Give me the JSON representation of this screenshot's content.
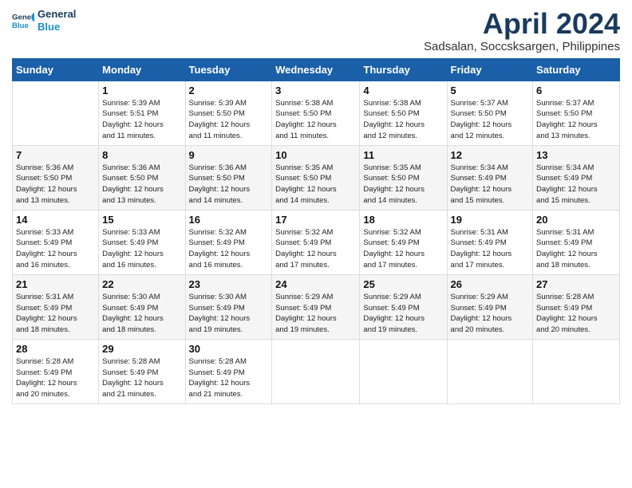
{
  "header": {
    "logo_line1": "General",
    "logo_line2": "Blue",
    "month": "April 2024",
    "location": "Sadsalan, Soccsksargen, Philippines"
  },
  "weekdays": [
    "Sunday",
    "Monday",
    "Tuesday",
    "Wednesday",
    "Thursday",
    "Friday",
    "Saturday"
  ],
  "weeks": [
    [
      {
        "day": "",
        "info": ""
      },
      {
        "day": "1",
        "info": "Sunrise: 5:39 AM\nSunset: 5:51 PM\nDaylight: 12 hours\nand 11 minutes."
      },
      {
        "day": "2",
        "info": "Sunrise: 5:39 AM\nSunset: 5:50 PM\nDaylight: 12 hours\nand 11 minutes."
      },
      {
        "day": "3",
        "info": "Sunrise: 5:38 AM\nSunset: 5:50 PM\nDaylight: 12 hours\nand 11 minutes."
      },
      {
        "day": "4",
        "info": "Sunrise: 5:38 AM\nSunset: 5:50 PM\nDaylight: 12 hours\nand 12 minutes."
      },
      {
        "day": "5",
        "info": "Sunrise: 5:37 AM\nSunset: 5:50 PM\nDaylight: 12 hours\nand 12 minutes."
      },
      {
        "day": "6",
        "info": "Sunrise: 5:37 AM\nSunset: 5:50 PM\nDaylight: 12 hours\nand 13 minutes."
      }
    ],
    [
      {
        "day": "7",
        "info": "Sunrise: 5:36 AM\nSunset: 5:50 PM\nDaylight: 12 hours\nand 13 minutes."
      },
      {
        "day": "8",
        "info": "Sunrise: 5:36 AM\nSunset: 5:50 PM\nDaylight: 12 hours\nand 13 minutes."
      },
      {
        "day": "9",
        "info": "Sunrise: 5:36 AM\nSunset: 5:50 PM\nDaylight: 12 hours\nand 14 minutes."
      },
      {
        "day": "10",
        "info": "Sunrise: 5:35 AM\nSunset: 5:50 PM\nDaylight: 12 hours\nand 14 minutes."
      },
      {
        "day": "11",
        "info": "Sunrise: 5:35 AM\nSunset: 5:50 PM\nDaylight: 12 hours\nand 14 minutes."
      },
      {
        "day": "12",
        "info": "Sunrise: 5:34 AM\nSunset: 5:49 PM\nDaylight: 12 hours\nand 15 minutes."
      },
      {
        "day": "13",
        "info": "Sunrise: 5:34 AM\nSunset: 5:49 PM\nDaylight: 12 hours\nand 15 minutes."
      }
    ],
    [
      {
        "day": "14",
        "info": "Sunrise: 5:33 AM\nSunset: 5:49 PM\nDaylight: 12 hours\nand 16 minutes."
      },
      {
        "day": "15",
        "info": "Sunrise: 5:33 AM\nSunset: 5:49 PM\nDaylight: 12 hours\nand 16 minutes."
      },
      {
        "day": "16",
        "info": "Sunrise: 5:32 AM\nSunset: 5:49 PM\nDaylight: 12 hours\nand 16 minutes."
      },
      {
        "day": "17",
        "info": "Sunrise: 5:32 AM\nSunset: 5:49 PM\nDaylight: 12 hours\nand 17 minutes."
      },
      {
        "day": "18",
        "info": "Sunrise: 5:32 AM\nSunset: 5:49 PM\nDaylight: 12 hours\nand 17 minutes."
      },
      {
        "day": "19",
        "info": "Sunrise: 5:31 AM\nSunset: 5:49 PM\nDaylight: 12 hours\nand 17 minutes."
      },
      {
        "day": "20",
        "info": "Sunrise: 5:31 AM\nSunset: 5:49 PM\nDaylight: 12 hours\nand 18 minutes."
      }
    ],
    [
      {
        "day": "21",
        "info": "Sunrise: 5:31 AM\nSunset: 5:49 PM\nDaylight: 12 hours\nand 18 minutes."
      },
      {
        "day": "22",
        "info": "Sunrise: 5:30 AM\nSunset: 5:49 PM\nDaylight: 12 hours\nand 18 minutes."
      },
      {
        "day": "23",
        "info": "Sunrise: 5:30 AM\nSunset: 5:49 PM\nDaylight: 12 hours\nand 19 minutes."
      },
      {
        "day": "24",
        "info": "Sunrise: 5:29 AM\nSunset: 5:49 PM\nDaylight: 12 hours\nand 19 minutes."
      },
      {
        "day": "25",
        "info": "Sunrise: 5:29 AM\nSunset: 5:49 PM\nDaylight: 12 hours\nand 19 minutes."
      },
      {
        "day": "26",
        "info": "Sunrise: 5:29 AM\nSunset: 5:49 PM\nDaylight: 12 hours\nand 20 minutes."
      },
      {
        "day": "27",
        "info": "Sunrise: 5:28 AM\nSunset: 5:49 PM\nDaylight: 12 hours\nand 20 minutes."
      }
    ],
    [
      {
        "day": "28",
        "info": "Sunrise: 5:28 AM\nSunset: 5:49 PM\nDaylight: 12 hours\nand 20 minutes."
      },
      {
        "day": "29",
        "info": "Sunrise: 5:28 AM\nSunset: 5:49 PM\nDaylight: 12 hours\nand 21 minutes."
      },
      {
        "day": "30",
        "info": "Sunrise: 5:28 AM\nSunset: 5:49 PM\nDaylight: 12 hours\nand 21 minutes."
      },
      {
        "day": "",
        "info": ""
      },
      {
        "day": "",
        "info": ""
      },
      {
        "day": "",
        "info": ""
      },
      {
        "day": "",
        "info": ""
      }
    ]
  ]
}
